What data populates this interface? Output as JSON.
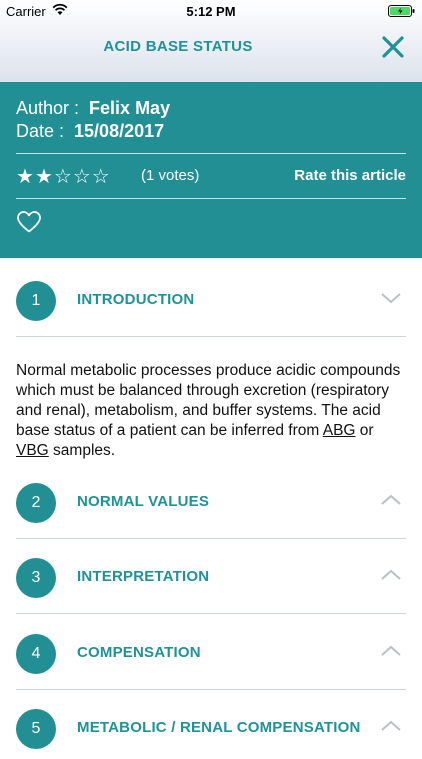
{
  "status_bar": {
    "carrier": "Carrier",
    "time": "5:12 PM"
  },
  "nav": {
    "title": "ACID BASE STATUS",
    "close_icon": "close-icon"
  },
  "article": {
    "author_label": "Author :",
    "author": "Felix May",
    "date_label": "Date :",
    "date": "15/08/2017",
    "rating": 2,
    "rating_max": 5,
    "votes": "(1 votes)",
    "rate_label": "Rate this article"
  },
  "intro": {
    "text_before": "Normal metabolic processes produce acidic compounds which must be balanced through excretion (respiratory and renal), metabolism, and buffer systems. The acid base status of a patient can be inferred from ",
    "link1": "ABG",
    "text_mid": " or ",
    "link2": "VBG",
    "text_after": " samples."
  },
  "sections": [
    {
      "number": "1",
      "title": "INTRODUCTION",
      "expanded": true
    },
    {
      "number": "2",
      "title": "NORMAL VALUES",
      "expanded": false
    },
    {
      "number": "3",
      "title": "INTERPRETATION",
      "expanded": false
    },
    {
      "number": "4",
      "title": "COMPENSATION",
      "expanded": false
    },
    {
      "number": "5",
      "title": "METABOLIC / RENAL COMPENSATION",
      "expanded": false
    }
  ],
  "colors": {
    "accent": "#218f94",
    "battery": "#4cd964"
  }
}
